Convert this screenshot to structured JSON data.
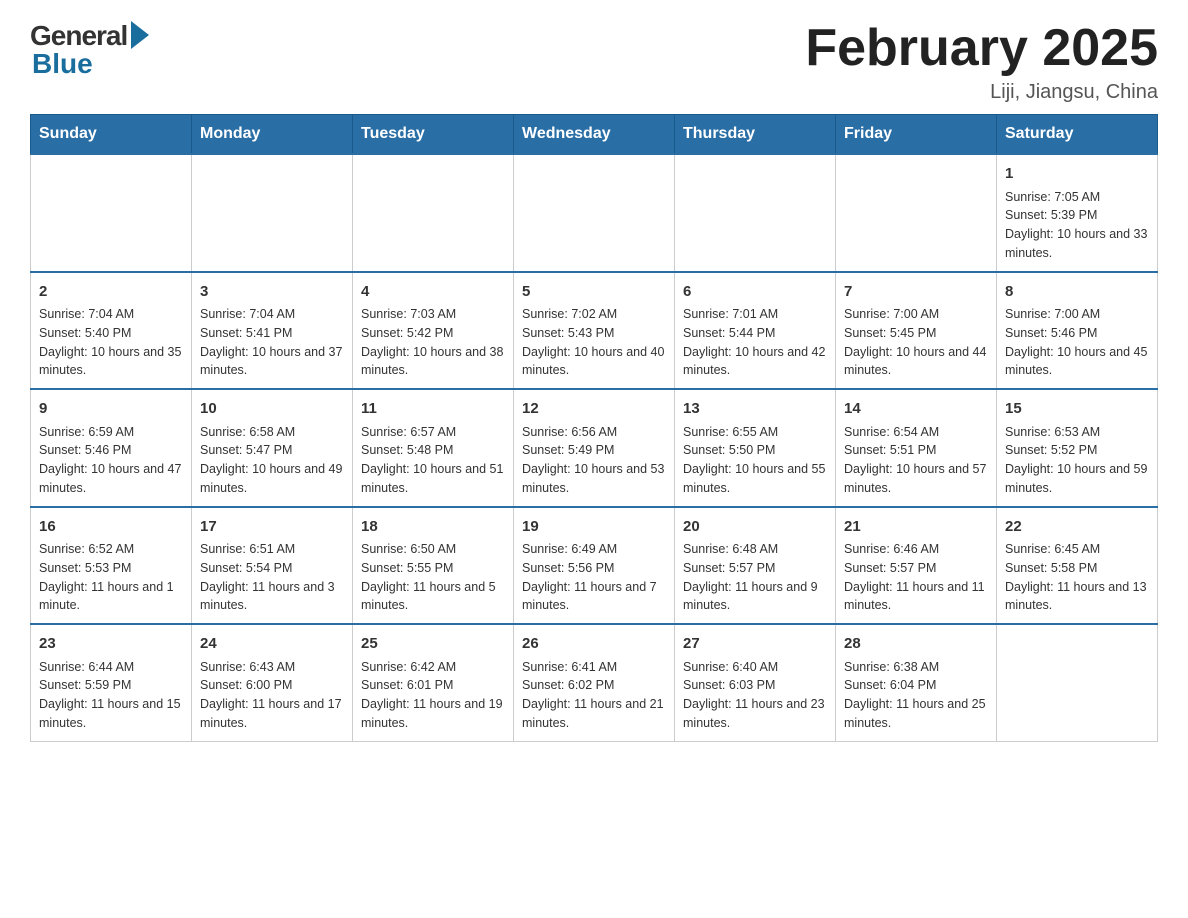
{
  "header": {
    "logo_general": "General",
    "logo_blue": "Blue",
    "title": "February 2025",
    "subtitle": "Liji, Jiangsu, China"
  },
  "days_of_week": [
    "Sunday",
    "Monday",
    "Tuesday",
    "Wednesday",
    "Thursday",
    "Friday",
    "Saturday"
  ],
  "weeks": [
    [
      {
        "day": "",
        "sunrise": "",
        "sunset": "",
        "daylight": ""
      },
      {
        "day": "",
        "sunrise": "",
        "sunset": "",
        "daylight": ""
      },
      {
        "day": "",
        "sunrise": "",
        "sunset": "",
        "daylight": ""
      },
      {
        "day": "",
        "sunrise": "",
        "sunset": "",
        "daylight": ""
      },
      {
        "day": "",
        "sunrise": "",
        "sunset": "",
        "daylight": ""
      },
      {
        "day": "",
        "sunrise": "",
        "sunset": "",
        "daylight": ""
      },
      {
        "day": "1",
        "sunrise": "Sunrise: 7:05 AM",
        "sunset": "Sunset: 5:39 PM",
        "daylight": "Daylight: 10 hours and 33 minutes."
      }
    ],
    [
      {
        "day": "2",
        "sunrise": "Sunrise: 7:04 AM",
        "sunset": "Sunset: 5:40 PM",
        "daylight": "Daylight: 10 hours and 35 minutes."
      },
      {
        "day": "3",
        "sunrise": "Sunrise: 7:04 AM",
        "sunset": "Sunset: 5:41 PM",
        "daylight": "Daylight: 10 hours and 37 minutes."
      },
      {
        "day": "4",
        "sunrise": "Sunrise: 7:03 AM",
        "sunset": "Sunset: 5:42 PM",
        "daylight": "Daylight: 10 hours and 38 minutes."
      },
      {
        "day": "5",
        "sunrise": "Sunrise: 7:02 AM",
        "sunset": "Sunset: 5:43 PM",
        "daylight": "Daylight: 10 hours and 40 minutes."
      },
      {
        "day": "6",
        "sunrise": "Sunrise: 7:01 AM",
        "sunset": "Sunset: 5:44 PM",
        "daylight": "Daylight: 10 hours and 42 minutes."
      },
      {
        "day": "7",
        "sunrise": "Sunrise: 7:00 AM",
        "sunset": "Sunset: 5:45 PM",
        "daylight": "Daylight: 10 hours and 44 minutes."
      },
      {
        "day": "8",
        "sunrise": "Sunrise: 7:00 AM",
        "sunset": "Sunset: 5:46 PM",
        "daylight": "Daylight: 10 hours and 45 minutes."
      }
    ],
    [
      {
        "day": "9",
        "sunrise": "Sunrise: 6:59 AM",
        "sunset": "Sunset: 5:46 PM",
        "daylight": "Daylight: 10 hours and 47 minutes."
      },
      {
        "day": "10",
        "sunrise": "Sunrise: 6:58 AM",
        "sunset": "Sunset: 5:47 PM",
        "daylight": "Daylight: 10 hours and 49 minutes."
      },
      {
        "day": "11",
        "sunrise": "Sunrise: 6:57 AM",
        "sunset": "Sunset: 5:48 PM",
        "daylight": "Daylight: 10 hours and 51 minutes."
      },
      {
        "day": "12",
        "sunrise": "Sunrise: 6:56 AM",
        "sunset": "Sunset: 5:49 PM",
        "daylight": "Daylight: 10 hours and 53 minutes."
      },
      {
        "day": "13",
        "sunrise": "Sunrise: 6:55 AM",
        "sunset": "Sunset: 5:50 PM",
        "daylight": "Daylight: 10 hours and 55 minutes."
      },
      {
        "day": "14",
        "sunrise": "Sunrise: 6:54 AM",
        "sunset": "Sunset: 5:51 PM",
        "daylight": "Daylight: 10 hours and 57 minutes."
      },
      {
        "day": "15",
        "sunrise": "Sunrise: 6:53 AM",
        "sunset": "Sunset: 5:52 PM",
        "daylight": "Daylight: 10 hours and 59 minutes."
      }
    ],
    [
      {
        "day": "16",
        "sunrise": "Sunrise: 6:52 AM",
        "sunset": "Sunset: 5:53 PM",
        "daylight": "Daylight: 11 hours and 1 minute."
      },
      {
        "day": "17",
        "sunrise": "Sunrise: 6:51 AM",
        "sunset": "Sunset: 5:54 PM",
        "daylight": "Daylight: 11 hours and 3 minutes."
      },
      {
        "day": "18",
        "sunrise": "Sunrise: 6:50 AM",
        "sunset": "Sunset: 5:55 PM",
        "daylight": "Daylight: 11 hours and 5 minutes."
      },
      {
        "day": "19",
        "sunrise": "Sunrise: 6:49 AM",
        "sunset": "Sunset: 5:56 PM",
        "daylight": "Daylight: 11 hours and 7 minutes."
      },
      {
        "day": "20",
        "sunrise": "Sunrise: 6:48 AM",
        "sunset": "Sunset: 5:57 PM",
        "daylight": "Daylight: 11 hours and 9 minutes."
      },
      {
        "day": "21",
        "sunrise": "Sunrise: 6:46 AM",
        "sunset": "Sunset: 5:57 PM",
        "daylight": "Daylight: 11 hours and 11 minutes."
      },
      {
        "day": "22",
        "sunrise": "Sunrise: 6:45 AM",
        "sunset": "Sunset: 5:58 PM",
        "daylight": "Daylight: 11 hours and 13 minutes."
      }
    ],
    [
      {
        "day": "23",
        "sunrise": "Sunrise: 6:44 AM",
        "sunset": "Sunset: 5:59 PM",
        "daylight": "Daylight: 11 hours and 15 minutes."
      },
      {
        "day": "24",
        "sunrise": "Sunrise: 6:43 AM",
        "sunset": "Sunset: 6:00 PM",
        "daylight": "Daylight: 11 hours and 17 minutes."
      },
      {
        "day": "25",
        "sunrise": "Sunrise: 6:42 AM",
        "sunset": "Sunset: 6:01 PM",
        "daylight": "Daylight: 11 hours and 19 minutes."
      },
      {
        "day": "26",
        "sunrise": "Sunrise: 6:41 AM",
        "sunset": "Sunset: 6:02 PM",
        "daylight": "Daylight: 11 hours and 21 minutes."
      },
      {
        "day": "27",
        "sunrise": "Sunrise: 6:40 AM",
        "sunset": "Sunset: 6:03 PM",
        "daylight": "Daylight: 11 hours and 23 minutes."
      },
      {
        "day": "28",
        "sunrise": "Sunrise: 6:38 AM",
        "sunset": "Sunset: 6:04 PM",
        "daylight": "Daylight: 11 hours and 25 minutes."
      },
      {
        "day": "",
        "sunrise": "",
        "sunset": "",
        "daylight": ""
      }
    ]
  ]
}
